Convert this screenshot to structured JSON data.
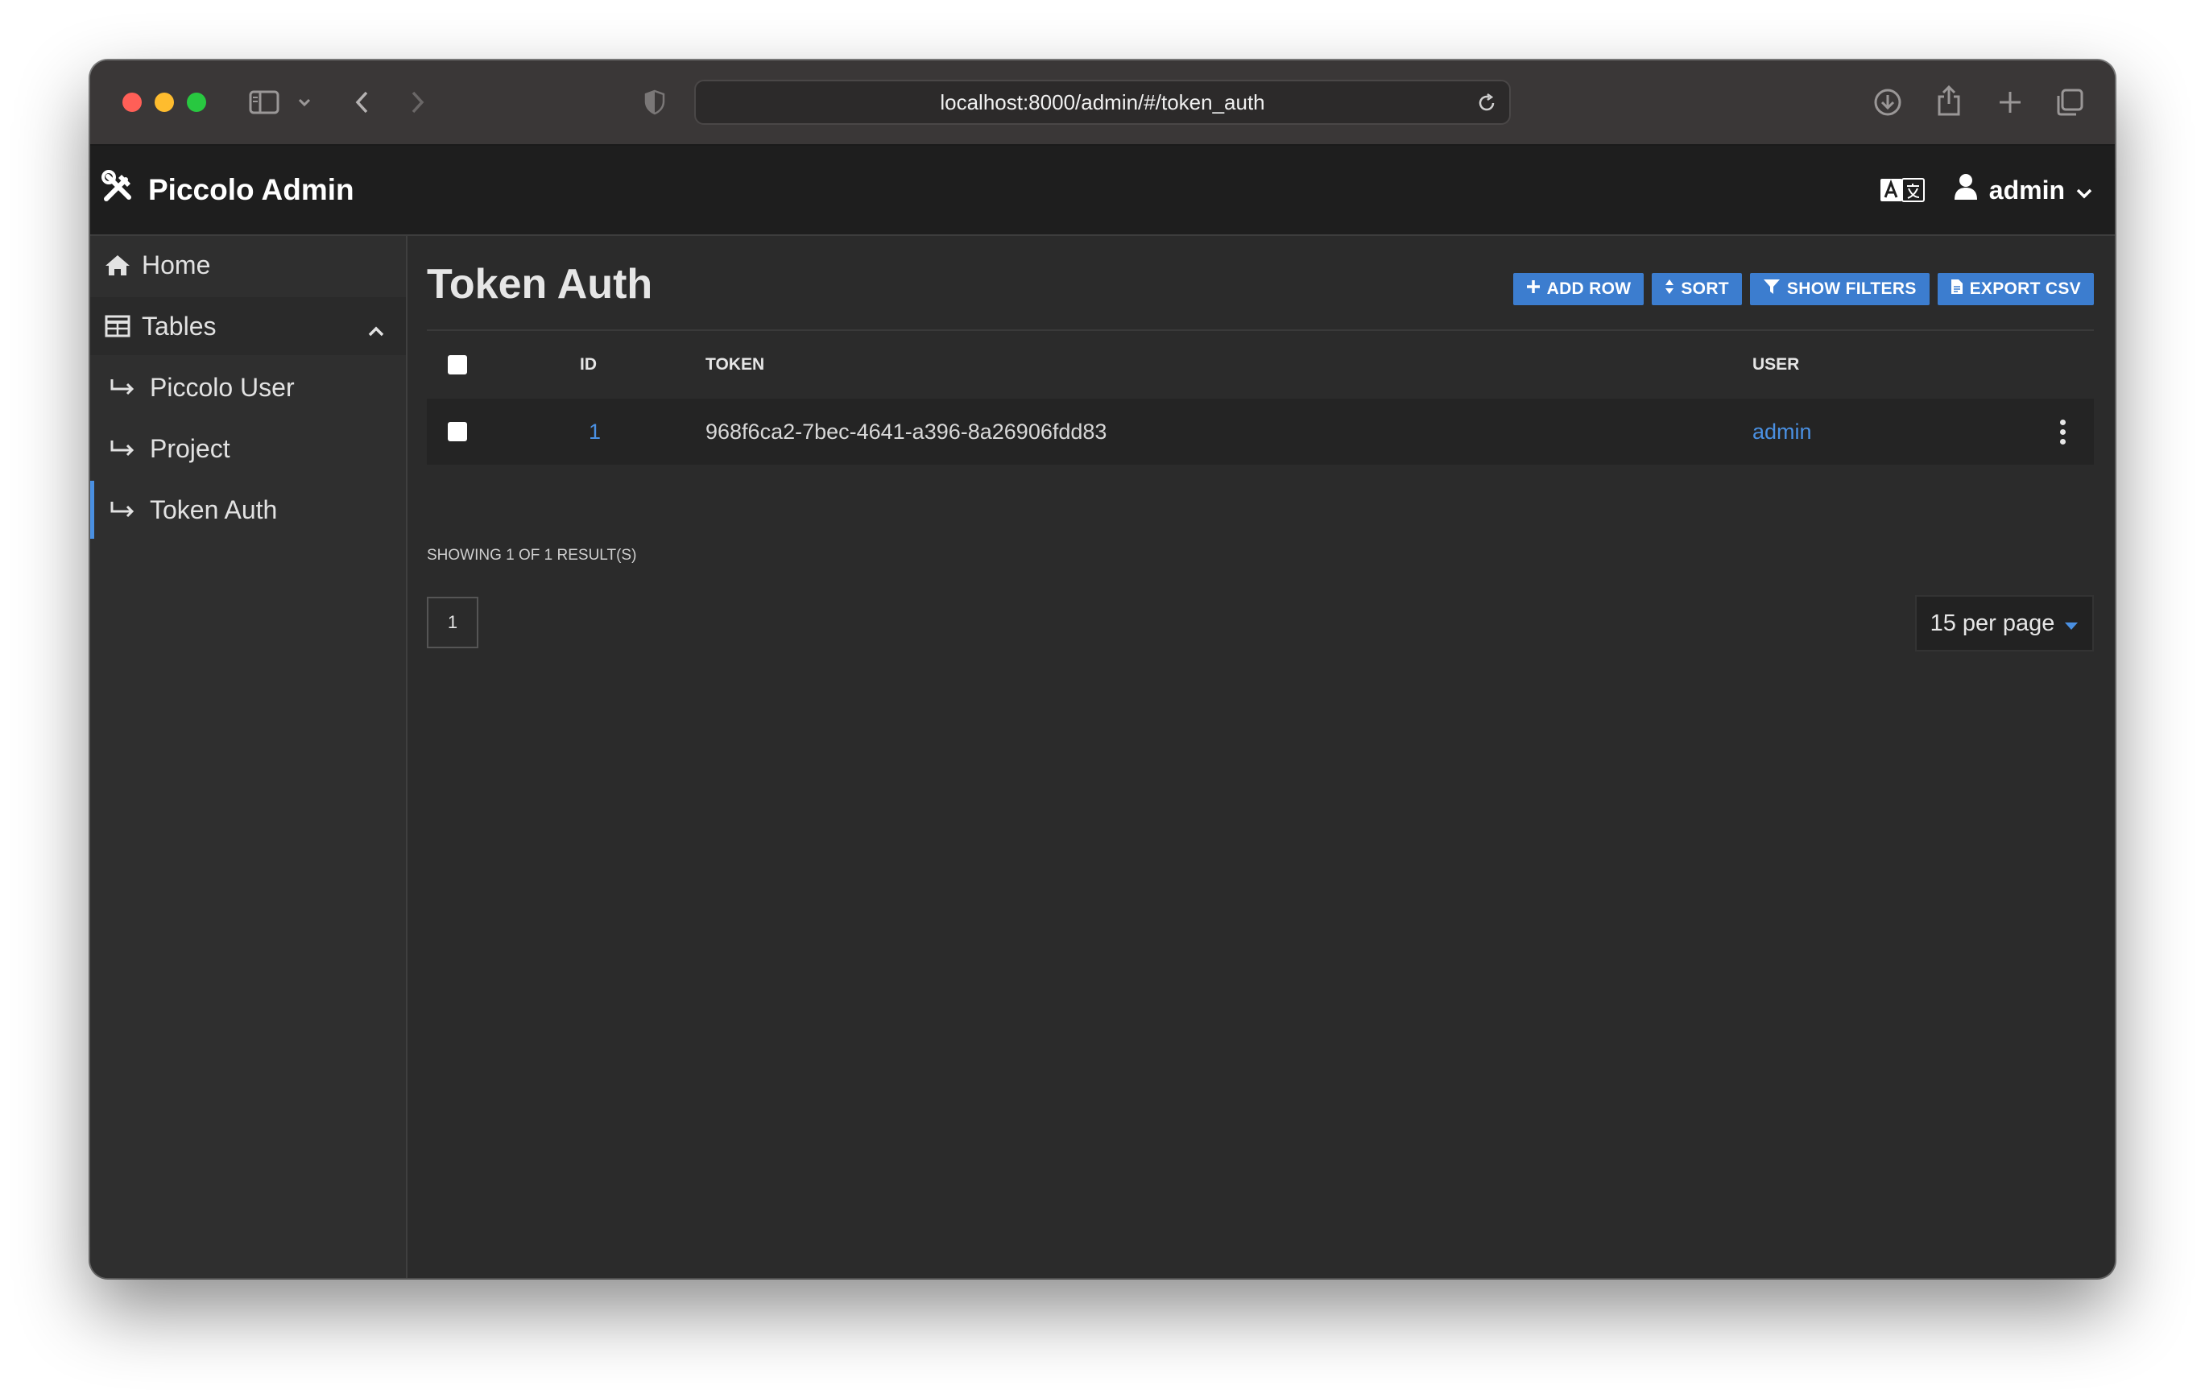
{
  "browser": {
    "url": "localhost:8000/admin/#/token_auth"
  },
  "header": {
    "brand": "Piccolo Admin",
    "username": "admin"
  },
  "sidebar": {
    "home": "Home",
    "tables": "Tables",
    "items": [
      "Piccolo User",
      "Project",
      "Token Auth"
    ]
  },
  "main": {
    "title": "Token Auth",
    "buttons": {
      "add_row": "ADD ROW",
      "sort": "SORT",
      "show_filters": "SHOW FILTERS",
      "export_csv": "EXPORT CSV"
    },
    "columns": {
      "id": "ID",
      "token": "TOKEN",
      "user": "USER"
    },
    "rows": [
      {
        "id": "1",
        "token": "968f6ca2-7bec-4641-a396-8a26906fdd83",
        "user": "admin"
      }
    ],
    "result_count": "SHOWING 1 OF 1 RESULT(S)",
    "page": "1",
    "per_page": "15 per page"
  },
  "colors": {
    "accent": "#3c7dcf",
    "link": "#4a90e2",
    "background": "#2b2b2b",
    "header": "#1e1e1e",
    "sidebar": "#2f2f2f"
  }
}
